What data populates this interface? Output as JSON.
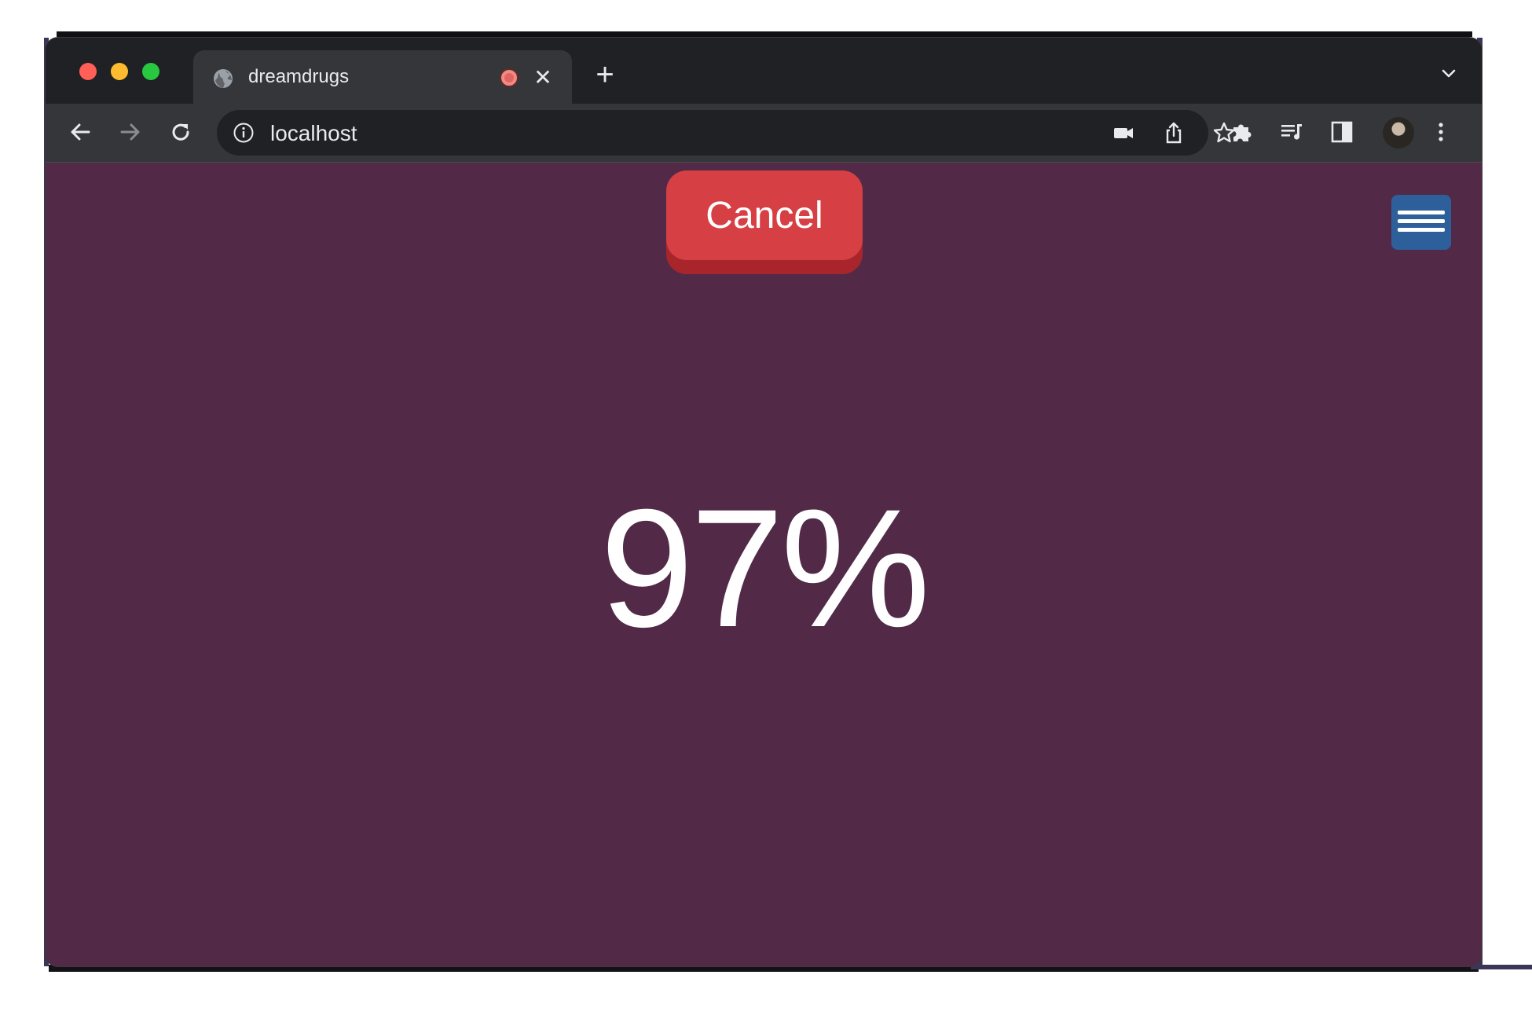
{
  "browser": {
    "tab_title": "dreamdrugs",
    "tab_close_glyph": "✕",
    "new_tab_glyph": "+",
    "url": "localhost"
  },
  "icons": {
    "favicon": "globe-icon",
    "recording": "recording-indicator-icon",
    "back": "arrow-left-icon",
    "forward": "arrow-right-icon",
    "reload": "reload-icon",
    "info": "info-icon",
    "camera": "camera-icon",
    "share": "share-icon",
    "bookmark": "star-icon",
    "extensions": "puzzle-icon",
    "media": "media-queue-icon",
    "sidepanel": "side-panel-icon",
    "menu": "kebab-menu-icon",
    "tab_search": "chevron-down-icon",
    "hamburger": "hamburger-icon"
  },
  "page": {
    "cancel_label": "Cancel",
    "progress_text": "97%",
    "progress_value": 97
  },
  "colors": {
    "page_background": "#522a47",
    "cancel_button": "#d63f43",
    "menu_button": "#2d5f9a"
  }
}
